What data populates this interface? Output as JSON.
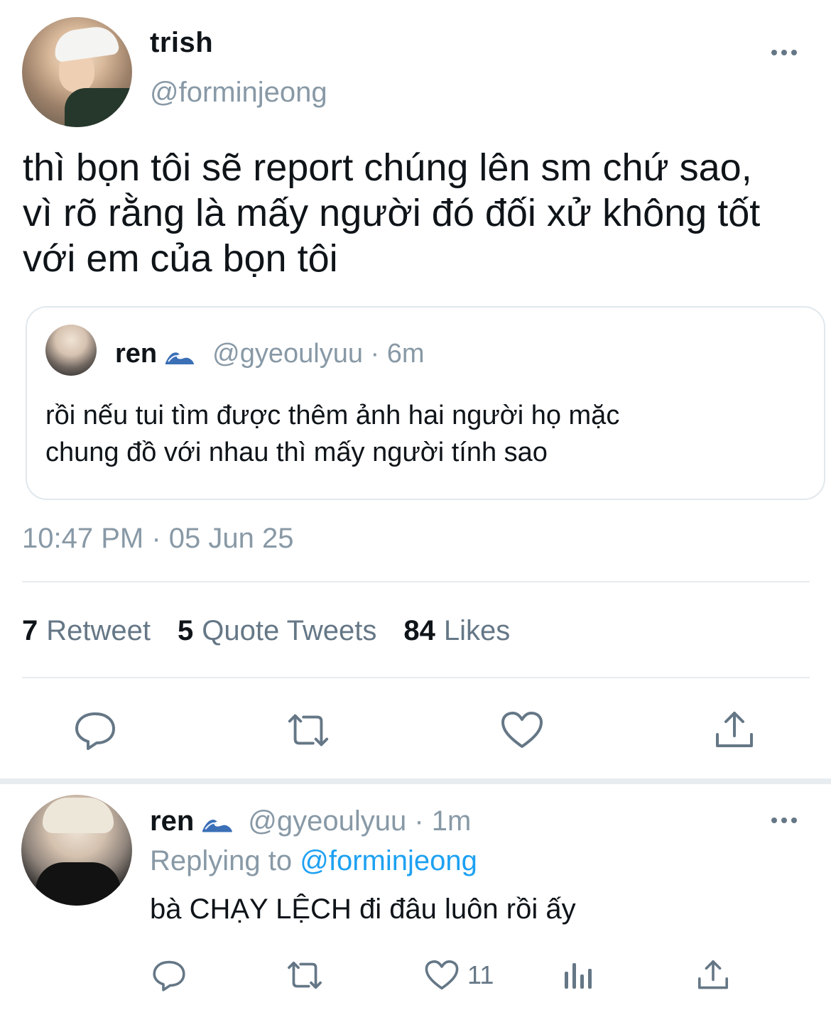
{
  "main_tweet": {
    "display_name": "trish",
    "handle": "@forminjeong",
    "text_lines": [
      "thì bọn tôi sẽ report chúng lên sm chứ sao,",
      "vì rõ rằng là mấy người đó đối xử không tốt",
      "với em của bọn tôi"
    ],
    "timestamp": "10:47 PM · 05 Jun 25",
    "stats": {
      "retweets_num": "7",
      "retweets_label": "Retweet",
      "quotes_num": "5",
      "quotes_label": "Quote Tweets",
      "likes_num": "84",
      "likes_label": "Likes"
    },
    "actions": [
      "reply-icon",
      "retweet-icon",
      "like-icon",
      "share-icon"
    ]
  },
  "quoted_tweet": {
    "display_name": "ren",
    "emoji_icon": "wave-icon",
    "meta": "@gyeoulyuu · 6m",
    "text_lines": [
      "rồi nếu tui tìm được thêm ảnh hai người họ mặc",
      "chung đồ với nhau thì mấy người tính sao"
    ]
  },
  "reply": {
    "display_name": "ren",
    "emoji_icon": "wave-icon",
    "meta": "@gyeoulyuu · 1m",
    "replying_prefix": "Replying to",
    "replying_to": "@forminjeong",
    "text": "bà CHẠY LỆCH đi đâu luôn rồi ấy",
    "like_count": "11",
    "actions": [
      "reply-icon",
      "retweet-icon",
      "like-icon",
      "analytics-icon",
      "share-icon"
    ]
  },
  "colors": {
    "text": "#0f1419",
    "secondary": "#8899a6",
    "icon": "#657786",
    "link": "#1da1f2",
    "divider": "#e6ecf0"
  }
}
